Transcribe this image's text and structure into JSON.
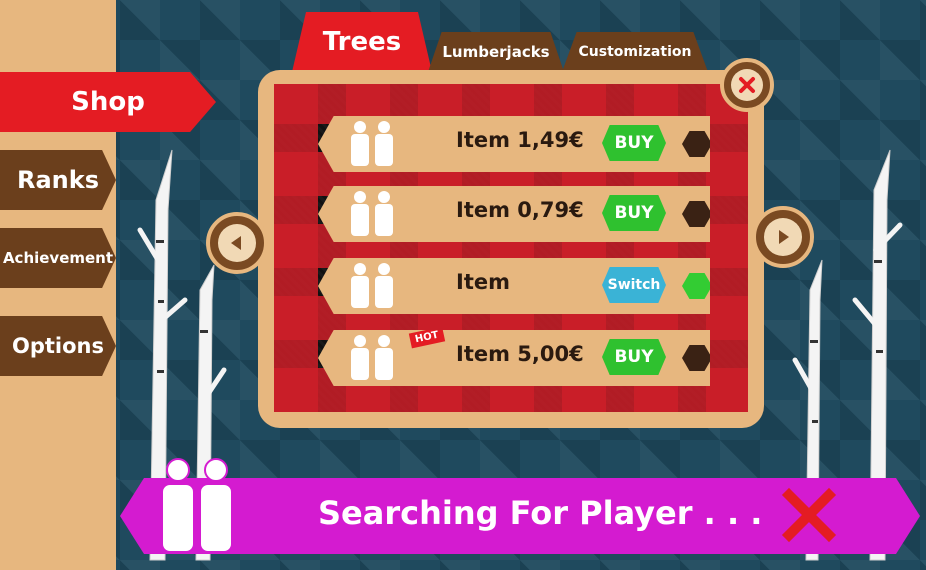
{
  "nav": {
    "items": [
      {
        "label": "Shop"
      },
      {
        "label": "Ranks"
      },
      {
        "label": "Achievement"
      },
      {
        "label": "Options"
      }
    ]
  },
  "tabs": [
    {
      "label": "Trees"
    },
    {
      "label": "Lumberjacks"
    },
    {
      "label": "Customization"
    }
  ],
  "shop_items": [
    {
      "label": "Item 1,49€",
      "action": "BUY",
      "indicator_color": "#3a2214"
    },
    {
      "label": "Item 0,79€",
      "action": "BUY",
      "indicator_color": "#3a2214"
    },
    {
      "label": "Item",
      "action": "Switch",
      "indicator_color": "#33cc33"
    },
    {
      "label": "Item 5,00€",
      "action": "BUY",
      "indicator_color": "#3a2214",
      "badge": "HOT"
    }
  ],
  "status": {
    "text": "Searching For Player . . ."
  },
  "colors": {
    "accent_red": "#e41c23",
    "buy_green": "#2fc12f",
    "switch_blue": "#3ab3d6",
    "banner_magenta": "#d41bd0",
    "wood_tan": "#e7b77f",
    "wood_brown": "#6b3f1c"
  },
  "icons": {
    "close": "close-icon",
    "prev": "chevron-left-icon",
    "next": "chevron-right-icon",
    "item": "lumberjack-silhouette-icon",
    "cancel": "cancel-x-icon"
  }
}
